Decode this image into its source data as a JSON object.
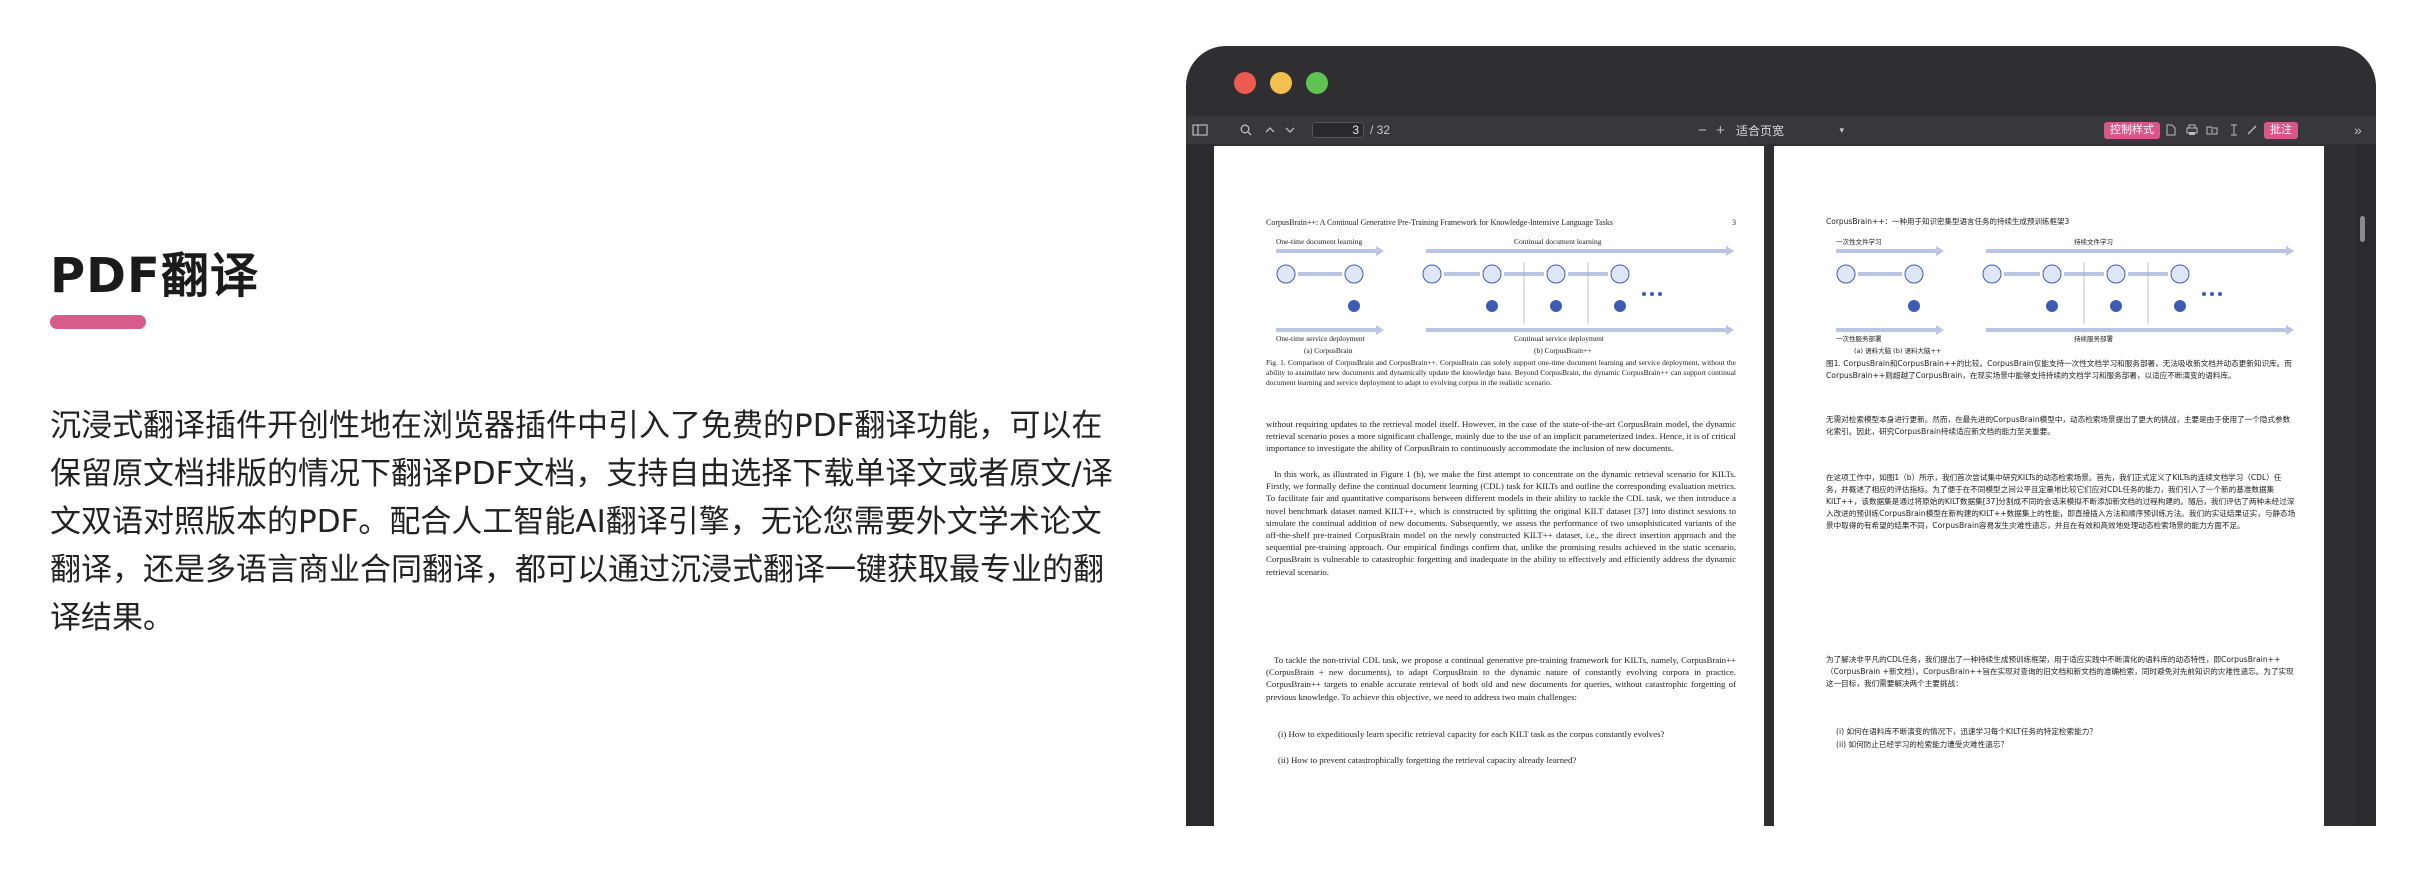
{
  "feature": {
    "title": "PDF翻译",
    "description": "沉浸式翻译插件开创性地在浏览器插件中引入了免费的PDF翻译功能，可以在保留原文档排版的情况下翻译PDF文档，支持自由选择下载单译文或者原文/译文双语对照版本的PDF。配合人工智能AI翻译引擎，无论您需要外文学术论文翻译，还是多语言商业合同翻译，都可以通过沉浸式翻译一键获取最专业的翻译结果。",
    "accent_color": "#d65c8a"
  },
  "viewer": {
    "toolbar": {
      "page_current": "3",
      "page_total": "/ 32",
      "zoom_select": "适合页宽",
      "control_style_button": "控制样式",
      "pink_button_2": "批注"
    },
    "left_page": {
      "header": "CorpusBrain++: A Continual Generative Pre-Training Framework for Knowledge-Intensive Language Tasks",
      "page_no": "3",
      "fig_left_title": "One-time document learning",
      "fig_right_title": "Continual document learning",
      "fig_left_bottom": "One-time service deployment",
      "fig_right_bottom": "Continual service deployment",
      "sub_a": "(a) CorpusBrain",
      "sub_b": "(b) CorpusBrain++",
      "fig_caption": "Fig. 1. Comparison of CorpusBrain and CorpusBrain++. CorpusBrain can solely support one-time document learning and service deployment, without the ability to assimilate new documents and dynamically update the knowledge base. Beyond CorpusBrain, the dynamic CorpusBrain++ can support continual document learning and service deployment to adapt to evolving corpus in the realistic scenario.",
      "p1": "without requiring updates to the retrieval model itself. However, in the case of the state-of-the-art CorpusBrain model, the dynamic retrieval scenario poses a more significant challenge, mainly due to the use of an implicit parameterized index. Hence, it is of critical importance to investigate the ability of CorpusBrain to continuously accommodate the inclusion of new documents.",
      "p2": "In this work, as illustrated in Figure 1 (b), we make the first attempt to concentrate on the dynamic retrieval scenario for KILTs. Firstly, we formally define the continual document learning (CDL) task for KILTs and outline the corresponding evaluation metrics. To facilitate fair and quantitative comparisons between different models in their ability to tackle the CDL task, we then introduce a novel benchmark dataset named KILT++, which is constructed by splitting the original KILT dataset [37] into distinct sessions to simulate the continual addition of new documents. Subsequently, we assess the performance of two unsophisticated variants of the off-the-shelf pre-trained CorpusBrain model on the newly constructed KILT++ dataset, i.e., the direct insertion approach and the sequential pre-training approach. Our empirical findings confirm that, unlike the promising results achieved in the static scenario, CorpusBrain is vulnerable to catastrophic forgetting and inadequate in the ability to effectively and efficiently address the dynamic retrieval scenario.",
      "p3": "To tackle the non-trivial CDL task, we propose a continual generative pre-training framework for KILTs, namely, CorpusBrain++ (CorpusBrain + new documents), to adapt CorpusBrain to the dynamic nature of constantly evolving corpora in practice. CorpusBrain++ targets to enable accurate retrieval of both old and new documents for queries, without catastrophic forgetting of previous knowledge. To achieve this objective, we need to address two main challenges:",
      "li1": "(i) How to expeditiously learn specific retrieval capacity for each KILT task as the corpus constantly evolves?",
      "li2": "(ii) How to prevent catastrophically forgetting the retrieval capacity already learned?"
    },
    "right_page": {
      "header": "CorpusBrain++：一种用于知识密集型语言任务的持续生成预训练框架3",
      "fig_left_title": "一次性文件学习",
      "fig_right_title": "持续文件学习",
      "fig_left_bottom": "一次性服务部署",
      "fig_right_bottom": "持续服务部署",
      "sub_ab": "(a) 语料大脑 (b) 语料大脑++",
      "fig_caption": "图1. CorpusBrain和CorpusBrain++的比较。CorpusBrain仅能支持一次性文档学习和服务部署，无法吸收新文档并动态更新知识库。而CorpusBrain++则超越了CorpusBrain，在现实场景中能够支持持续的文档学习和服务部署，以适应不断演变的语料库。",
      "p1": "无需对检索模型本身进行更新。然而，在最先进的CorpusBrain模型中，动态检索场景提出了更大的挑战，主要是由于使用了一个隐式参数化索引。因此，研究CorpusBrain持续适应新文档的能力至关重要。",
      "p2": "在这项工作中，如图1（b）所示，我们首次尝试集中研究KILTs的动态检索场景。首先，我们正式定义了KILTs的连续文档学习（CDL）任务，并概述了相应的评估指标。为了便于在不同模型之间公平且定量地比较它们应对CDL任务的能力，我们引入了一个新的基准数据集KILT++，该数据集是通过将原始的KILT数据集[37]分割成不同的会话来模拟不断添加新文档的过程构建的。随后，我们评估了两种未经过深入改进的预训练CorpusBrain模型在新构建的KILT++数据集上的性能，即直接插入方法和顺序预训练方法。我们的实证结果证实，与静态场景中取得的有希望的结果不同，CorpusBrain容易发生灾难性遗忘，并且在有效和高效地处理动态检索场景的能力方面不足。",
      "p3": "为了解决非平凡的CDL任务，我们提出了一种持续生成预训练框架，用于适应实践中不断演化的语料库的动态特性，即CorpusBrain++（CorpusBrain +新文档）。CorpusBrain++旨在实现对查询的旧文档和新文档的准确检索，同时避免对先前知识的灾难性遗忘。为了实现这一目标，我们需要解决两个主要挑战：",
      "li1": "(i) 如何在语料库不断演变的情况下，迅速学习每个KILT任务的特定检索能力？",
      "li2": "(ii) 如何防止已经学习的检索能力遭受灾难性遗忘？"
    }
  }
}
